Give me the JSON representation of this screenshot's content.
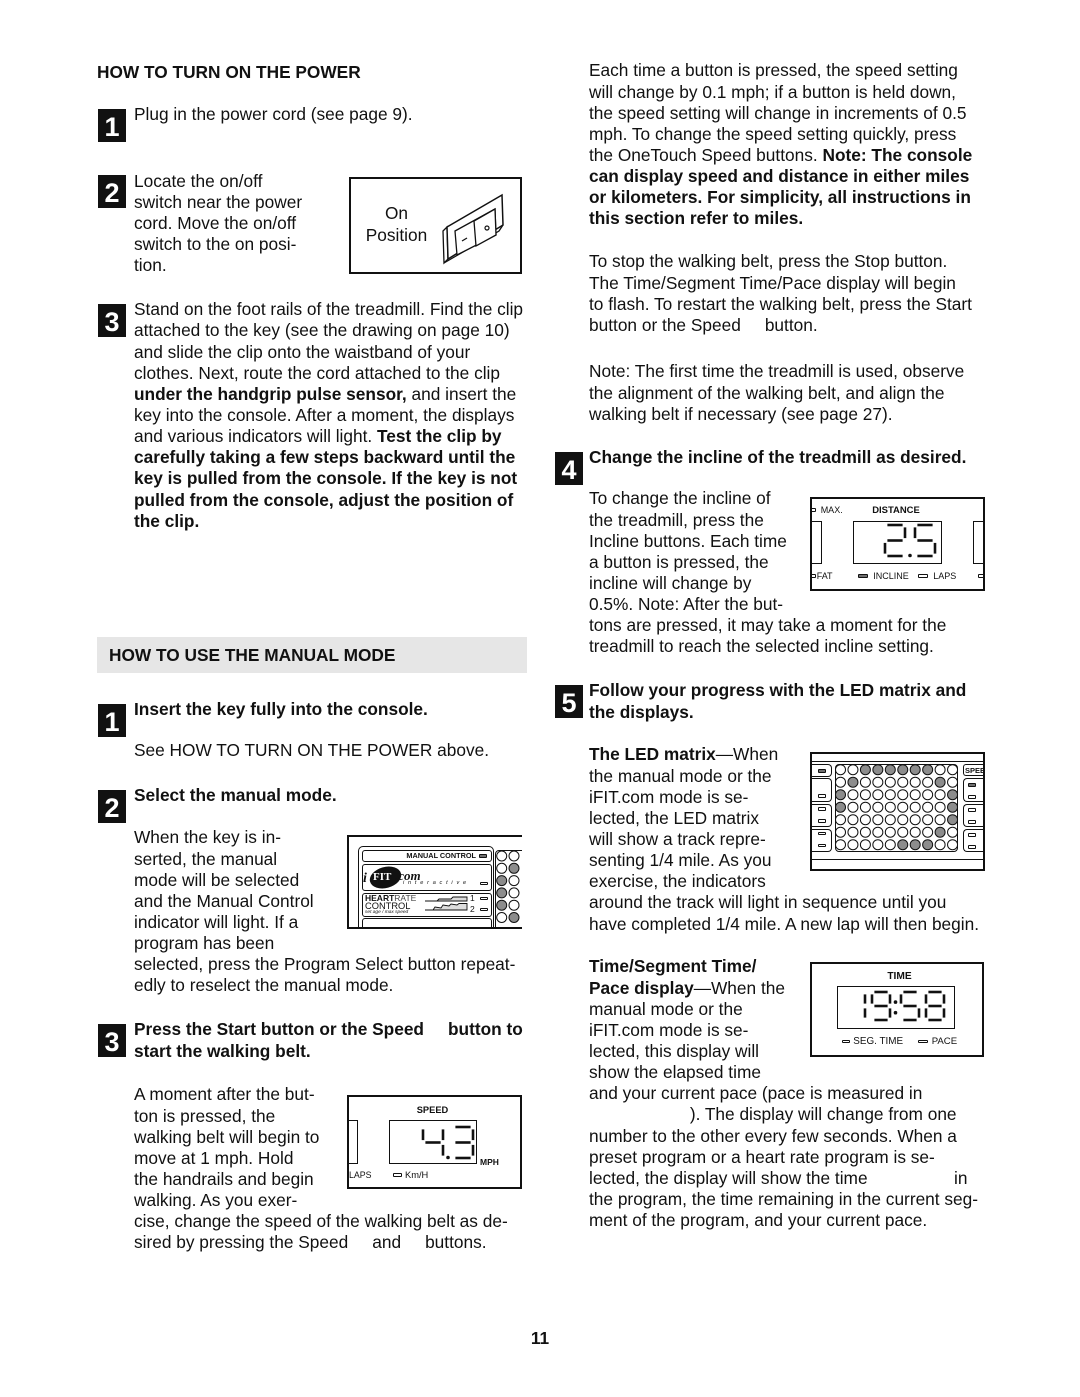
{
  "page_number": "11",
  "left": {
    "power": {
      "heading": "HOW TO TURN ON THE POWER",
      "steps": [
        {
          "number": "1",
          "lines": [
            "Plug in the power cord (see page 9)."
          ]
        },
        {
          "number": "2",
          "lines": [
            "Locate the on/off",
            "switch near the power",
            "cord. Move the on/off",
            "switch to the on posi-",
            "tion."
          ]
        },
        {
          "number": "3",
          "lines": [
            "Stand on the foot rails of the treadmill. Find the clip",
            "attached to the key (see the drawing on page 10)",
            "and slide the clip onto the waistband of your",
            "clothes. Next, route the cord attached to the clip",
            [
              {
                "t": "under the handgrip pulse sensor,",
                "b": true
              },
              {
                "t": " and insert the"
              }
            ],
            "key into the console. After a moment, the displays",
            [
              {
                "t": "and various indicators will light. "
              },
              {
                "t": "Test the clip by",
                "b": true
              }
            ],
            {
              "t": "carefully taking a few steps backward until the",
              "b": true
            },
            {
              "t": "key is pulled from the console. If the key is not",
              "b": true
            },
            {
              "t": "pulled from the console, adjust the position of",
              "b": true
            },
            {
              "t": "the clip.",
              "b": true
            }
          ]
        }
      ],
      "switch_figure": {
        "label_lines": [
          "On",
          "Position"
        ]
      }
    },
    "manual": {
      "heading": "HOW TO USE THE MANUAL MODE",
      "steps": [
        {
          "number": "1",
          "title_lines": [
            {
              "t": "Insert the key fully into the console.",
              "b": true
            }
          ],
          "body_lines": [
            "See HOW TO TURN ON THE POWER above."
          ]
        },
        {
          "number": "2",
          "title_lines": [
            {
              "t": "Select the manual mode.",
              "b": true
            }
          ],
          "body_lines": [
            "When the key is in-",
            "serted, the manual",
            "mode will be selected",
            "and the Manual Control",
            "indicator will light. If a",
            "program has been",
            "selected, press the Program Select button repeat-",
            "edly to reselect the manual mode."
          ]
        },
        {
          "number": "3",
          "title_lines": [
            {
              "t": "Press the Start button or the Speed     button to",
              "b": true
            },
            {
              "t": "start the walking belt.",
              "b": true
            }
          ],
          "body_lines": [
            "A moment after the but-",
            "ton is pressed, the",
            "walking belt will begin to",
            "move at 1 mph. Hold",
            "the handrails and begin",
            "walking. As you exer-",
            "cise, change the speed of the walking belt as de-",
            "sired by pressing the Speed     and     buttons."
          ]
        }
      ],
      "console_figure": {
        "manual_control_label": "MANUAL CONTROL",
        "manual_control_lit": true,
        "logo": {
          "i": "i",
          "fit": "FIT",
          "com": ".com",
          "tagline": "interactive"
        },
        "heart_rate": {
          "heart": "HEART",
          "rate": "RATE",
          "control": "CONTROL",
          "subtitle": "set age / max speed",
          "program_1": "1",
          "program_2": "2"
        },
        "led_rows": [
          "00",
          "01",
          "10",
          "10",
          "10",
          "01"
        ]
      },
      "speed_figure": {
        "title": "SPEED",
        "value": "4.3",
        "unit": "MPH",
        "laps_label": "LAPS",
        "alt_unit_label": "Km/H"
      }
    }
  },
  "right": {
    "paragraphs": [
      [
        "Each time a button is pressed, the speed setting",
        "will change by 0.1 mph; if a button is held down,",
        "the speed setting will change in increments of 0.5",
        "mph. To change the speed setting quickly, press",
        [
          {
            "t": "the OneTouch Speed buttons. "
          },
          {
            "t": "Note: The console",
            "b": true
          }
        ],
        {
          "t": "can display speed and distance in either miles",
          "b": true
        },
        {
          "t": "or kilometers. For simplicity, all instructions in",
          "b": true
        },
        {
          "t": "this section refer to miles.",
          "b": true
        }
      ],
      [
        "To stop the walking belt, press the Stop button.",
        "The Time/Segment Time/Pace display will begin",
        "to flash. To restart the walking belt, press the Start",
        "button or the Speed     button."
      ],
      [
        "Note: The first time the treadmill is used, observe",
        "the alignment of the walking belt, and align the",
        "walking belt if necessary (see page 27)."
      ]
    ],
    "steps": [
      {
        "number": "4",
        "title_lines": [
          {
            "t": "Change the incline of the treadmill as desired.",
            "b": true
          }
        ],
        "body_lines": [
          "To change the incline of",
          "the treadmill, press the",
          "Incline buttons. Each time",
          "a button is pressed, the",
          "incline will change by",
          "0.5%. Note: After the but-",
          "tons are pressed, it may take a moment for the",
          "treadmill to reach the selected incline setting."
        ]
      },
      {
        "number": "5",
        "title_lines": [
          {
            "t": "Follow your progress with the LED matrix and",
            "b": true
          },
          {
            "t": "the displays.",
            "b": true
          }
        ],
        "led_lines": [
          [
            {
              "t": "The LED matrix",
              "b": true
            },
            {
              "t": "—When"
            }
          ],
          "the manual mode or the",
          "iFIT.com mode is se-",
          "lected, the LED matrix",
          "will show a track repre-",
          "senting 1/4 mile. As you",
          "exercise, the indicators",
          "around the track will light in sequence until you",
          "have completed 1/4 mile. A new lap will then begin."
        ],
        "time_lines": [
          {
            "t": "Time/Segment Time/",
            "b": true
          },
          [
            {
              "t": "Pace display",
              "b": true
            },
            {
              "t": "—When the"
            }
          ],
          "manual mode or the",
          "iFIT.com mode is se-",
          "lected, this display will",
          "show the elapsed time",
          "and your current pace (pace is measured in",
          "                     ). The display will change from one",
          "number to the other every few seconds. When a",
          "preset program or a heart rate program is se-",
          "lected, the display will show the time                  in",
          "the program, the time remaining in the current seg-",
          "ment of the program, and your current pace."
        ]
      }
    ],
    "distance_figure": {
      "max_label": "MAX.",
      "title": "DISTANCE",
      "value": "2.5",
      "fat_label": "FAT",
      "incline_label": "INCLINE",
      "incline_lit": true,
      "laps_label": "LAPS"
    },
    "led_figure": {
      "speed_label": "SPEED",
      "matrix": [
        "0011111100",
        "0100000010",
        "1000000001",
        "1000000001",
        "0000000001",
        "0000000010",
        "0000011100"
      ]
    },
    "time_figure": {
      "title": "TIME",
      "value": "19:58",
      "seg_time_label": "SEG. TIME",
      "pace_label": "PACE"
    }
  }
}
